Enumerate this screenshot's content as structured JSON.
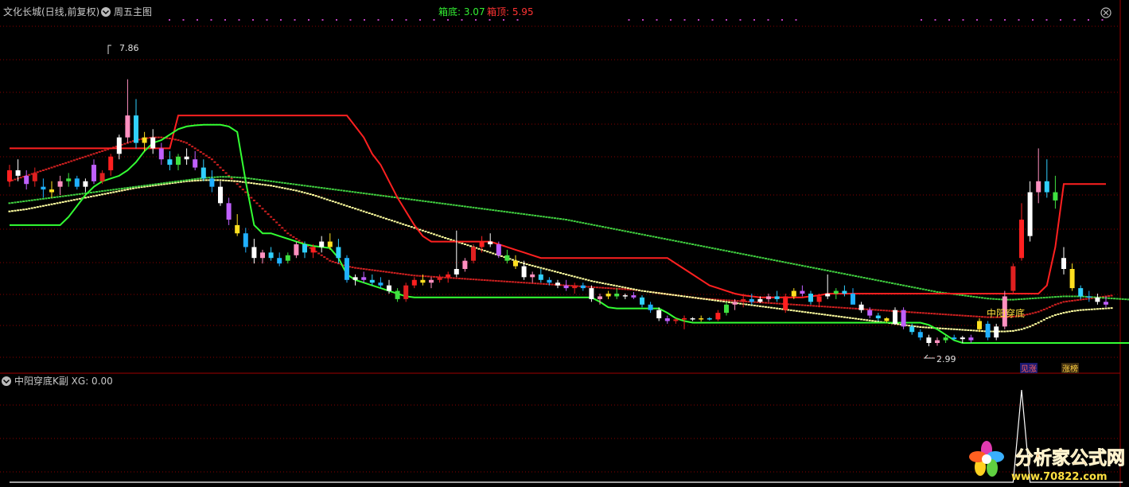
{
  "main_panel": {
    "stock_title": "文化长城(日线,前复权)",
    "indicator_name": "周五主图",
    "box_bottom_label": "箱底: 3.07",
    "box_top_label": "箱顶: 5.95",
    "high_label": "7.86",
    "low_label": "2.99",
    "signal_label": "中阳穿底",
    "tag_one": "见涨",
    "tag_two": "涨榜"
  },
  "sub_panel": {
    "title": "中阳穿底K副 XG: 0.00"
  },
  "watermark": {
    "name": "分析家公式网",
    "url": "www.70822.com"
  },
  "colors": {
    "background": "#000000",
    "grid": "#8a0000",
    "box_line": "#ff2020",
    "support_line": "#33ff33",
    "ma_red": "#d02020",
    "ma_yellow": "#ffffa0",
    "ma_green": "#40d040",
    "signal_spike": "#ffffff",
    "box_bottom_text": "#33ee33",
    "box_top_text": "#ff3333"
  },
  "icons": {
    "menu": "chevron-down-icon",
    "close": "close-icon"
  },
  "chart_data": {
    "type": "candlestick",
    "y_range": [
      2.6,
      8.9
    ],
    "price_high": 7.86,
    "price_low": 2.99,
    "box_bottom": 3.07,
    "box_top": 5.95,
    "candles": [
      [
        6.0,
        6.3,
        5.9,
        6.2
      ],
      [
        6.2,
        6.4,
        6.0,
        6.1
      ],
      [
        6.1,
        6.2,
        5.85,
        5.95
      ],
      [
        6.0,
        6.25,
        5.9,
        6.15
      ],
      [
        5.9,
        6.05,
        5.7,
        5.85
      ],
      [
        5.85,
        6.0,
        5.7,
        5.8
      ],
      [
        5.9,
        6.1,
        5.75,
        6.0
      ],
      [
        6.0,
        6.15,
        5.9,
        6.05
      ],
      [
        6.05,
        6.1,
        5.85,
        5.9
      ],
      [
        5.9,
        6.05,
        5.8,
        6.0
      ],
      [
        6.3,
        6.4,
        5.95,
        6.0
      ],
      [
        6.0,
        6.2,
        5.95,
        6.15
      ],
      [
        6.2,
        6.5,
        6.1,
        6.45
      ],
      [
        6.5,
        6.85,
        6.4,
        6.8
      ],
      [
        6.8,
        7.86,
        6.7,
        7.2
      ],
      [
        7.2,
        7.5,
        6.6,
        6.7
      ],
      [
        6.7,
        6.9,
        6.55,
        6.8
      ],
      [
        6.8,
        6.95,
        6.5,
        6.6
      ],
      [
        6.6,
        6.7,
        6.3,
        6.4
      ],
      [
        6.4,
        6.55,
        6.2,
        6.3
      ],
      [
        6.3,
        6.5,
        6.2,
        6.45
      ],
      [
        6.45,
        6.6,
        6.3,
        6.4
      ],
      [
        6.4,
        6.55,
        6.2,
        6.25
      ],
      [
        6.25,
        6.4,
        6.0,
        6.05
      ],
      [
        6.05,
        6.2,
        5.8,
        5.9
      ],
      [
        5.9,
        6.0,
        5.55,
        5.6
      ],
      [
        5.6,
        5.7,
        5.2,
        5.3
      ],
      [
        5.2,
        5.4,
        5.0,
        5.05
      ],
      [
        5.05,
        5.15,
        4.7,
        4.8
      ],
      [
        4.8,
        4.95,
        4.5,
        4.6
      ],
      [
        4.6,
        4.75,
        4.5,
        4.7
      ],
      [
        4.7,
        4.8,
        4.55,
        4.6
      ],
      [
        4.6,
        4.7,
        4.45,
        4.5
      ],
      [
        4.55,
        4.7,
        4.5,
        4.65
      ],
      [
        4.65,
        4.9,
        4.6,
        4.85
      ],
      [
        4.85,
        4.9,
        4.6,
        4.7
      ],
      [
        4.7,
        4.85,
        4.6,
        4.8
      ],
      [
        4.8,
        5.0,
        4.7,
        4.9
      ],
      [
        4.9,
        5.05,
        4.75,
        4.8
      ],
      [
        4.8,
        4.95,
        4.5,
        4.6
      ],
      [
        4.6,
        4.65,
        4.15,
        4.2
      ],
      [
        4.2,
        4.3,
        4.1,
        4.25
      ],
      [
        4.25,
        4.35,
        4.15,
        4.2
      ],
      [
        4.2,
        4.3,
        4.1,
        4.15
      ],
      [
        4.15,
        4.25,
        4.05,
        4.1
      ],
      [
        4.1,
        4.2,
        3.95,
        4.0
      ],
      [
        4.0,
        4.05,
        3.8,
        3.85
      ],
      [
        3.85,
        4.15,
        3.8,
        4.1
      ],
      [
        4.1,
        4.25,
        4.05,
        4.2
      ],
      [
        4.2,
        4.3,
        4.1,
        4.15
      ],
      [
        4.15,
        4.25,
        4.05,
        4.2
      ],
      [
        4.2,
        4.3,
        4.15,
        4.25
      ],
      [
        4.25,
        4.35,
        4.15,
        4.3
      ],
      [
        4.3,
        5.1,
        4.25,
        4.4
      ],
      [
        4.4,
        4.6,
        4.35,
        4.55
      ],
      [
        4.55,
        4.85,
        4.5,
        4.8
      ],
      [
        4.8,
        5.0,
        4.7,
        4.9
      ],
      [
        4.9,
        5.05,
        4.8,
        4.85
      ],
      [
        4.85,
        4.9,
        4.6,
        4.65
      ],
      [
        4.65,
        4.75,
        4.5,
        4.55
      ],
      [
        4.55,
        4.65,
        4.4,
        4.45
      ],
      [
        4.45,
        4.55,
        4.2,
        4.25
      ],
      [
        4.25,
        4.35,
        4.15,
        4.3
      ],
      [
        4.3,
        4.4,
        4.15,
        4.2
      ],
      [
        4.2,
        4.25,
        4.1,
        4.15
      ],
      [
        4.15,
        4.2,
        4.05,
        4.1
      ],
      [
        4.1,
        4.2,
        4.0,
        4.05
      ],
      [
        4.05,
        4.15,
        3.95,
        4.1
      ],
      [
        4.1,
        4.15,
        4.0,
        4.05
      ],
      [
        4.05,
        4.1,
        3.8,
        3.85
      ],
      [
        3.85,
        3.95,
        3.75,
        3.9
      ],
      [
        3.9,
        4.0,
        3.85,
        3.95
      ],
      [
        3.95,
        4.05,
        3.85,
        3.9
      ],
      [
        3.9,
        3.95,
        3.85,
        3.92
      ],
      [
        3.92,
        3.98,
        3.85,
        3.88
      ],
      [
        3.88,
        3.92,
        3.7,
        3.75
      ],
      [
        3.75,
        3.8,
        3.6,
        3.65
      ],
      [
        3.65,
        3.7,
        3.45,
        3.5
      ],
      [
        3.5,
        3.55,
        3.4,
        3.45
      ],
      [
        3.45,
        3.5,
        3.4,
        3.48
      ],
      [
        3.48,
        3.55,
        3.3,
        3.5
      ],
      [
        3.5,
        3.52,
        3.45,
        3.48
      ],
      [
        3.48,
        3.55,
        3.44,
        3.5
      ],
      [
        3.5,
        3.52,
        3.46,
        3.48
      ],
      [
        3.48,
        3.65,
        3.45,
        3.6
      ],
      [
        3.6,
        3.8,
        3.55,
        3.75
      ],
      [
        3.75,
        3.85,
        3.65,
        3.8
      ],
      [
        3.8,
        3.95,
        3.7,
        3.85
      ],
      [
        3.85,
        3.95,
        3.75,
        3.8
      ],
      [
        3.8,
        3.9,
        3.78,
        3.85
      ],
      [
        3.85,
        3.95,
        3.8,
        3.9
      ],
      [
        3.9,
        4.0,
        3.8,
        3.85
      ],
      [
        3.65,
        3.95,
        3.6,
        3.9
      ],
      [
        3.9,
        4.05,
        3.85,
        4.0
      ],
      [
        4.0,
        4.1,
        3.9,
        3.95
      ],
      [
        3.95,
        4.0,
        3.75,
        3.8
      ],
      [
        3.8,
        3.95,
        3.7,
        3.9
      ],
      [
        3.9,
        4.3,
        3.85,
        3.95
      ],
      [
        3.95,
        4.05,
        3.85,
        4.0
      ],
      [
        4.0,
        4.1,
        3.9,
        3.95
      ],
      [
        3.95,
        4.05,
        3.85,
        3.75
      ],
      [
        3.75,
        3.8,
        3.6,
        3.65
      ],
      [
        3.65,
        3.7,
        3.5,
        3.55
      ],
      [
        3.55,
        3.6,
        3.45,
        3.5
      ],
      [
        3.5,
        3.52,
        3.42,
        3.45
      ],
      [
        3.4,
        3.7,
        3.38,
        3.65
      ],
      [
        3.65,
        3.7,
        3.3,
        3.35
      ],
      [
        3.35,
        3.4,
        3.2,
        3.25
      ],
      [
        3.25,
        3.3,
        3.1,
        3.15
      ],
      [
        3.15,
        3.2,
        2.99,
        3.05
      ],
      [
        3.05,
        3.15,
        3.0,
        3.1
      ],
      [
        3.1,
        3.2,
        3.05,
        3.15
      ],
      [
        3.15,
        3.2,
        3.1,
        3.12
      ],
      [
        3.12,
        3.18,
        3.05,
        3.15
      ],
      [
        3.15,
        3.2,
        3.05,
        3.1
      ],
      [
        3.3,
        3.5,
        3.25,
        3.45
      ],
      [
        3.4,
        3.45,
        3.1,
        3.15
      ],
      [
        3.15,
        3.4,
        3.1,
        3.35
      ],
      [
        3.35,
        4.0,
        3.3,
        3.9
      ],
      [
        4.0,
        4.5,
        3.95,
        4.45
      ],
      [
        4.6,
        5.6,
        4.55,
        5.3
      ],
      [
        5.0,
        6.0,
        4.9,
        5.8
      ],
      [
        5.8,
        6.6,
        5.6,
        6.0
      ],
      [
        6.0,
        6.4,
        5.7,
        5.8
      ],
      [
        5.8,
        6.1,
        5.5,
        5.65
      ],
      [
        4.6,
        4.8,
        4.3,
        4.4
      ],
      [
        4.4,
        4.5,
        4.0,
        4.05
      ],
      [
        4.05,
        4.1,
        3.85,
        3.9
      ],
      [
        3.9,
        4.0,
        3.8,
        3.88
      ],
      [
        3.88,
        3.95,
        3.75,
        3.8
      ],
      [
        3.8,
        3.9,
        3.7,
        3.75
      ]
    ],
    "box_line": [
      6.6,
      6.6,
      6.6,
      6.6,
      6.6,
      6.6,
      6.6,
      6.6,
      6.6,
      6.6,
      6.6,
      6.6,
      6.6,
      6.6,
      6.6,
      6.6,
      6.6,
      6.6,
      6.6,
      6.6,
      7.2,
      7.2,
      7.2,
      7.2,
      7.2,
      7.2,
      7.2,
      7.2,
      7.2,
      7.2,
      7.2,
      7.2,
      7.2,
      7.2,
      7.2,
      7.2,
      7.2,
      7.2,
      7.2,
      7.2,
      7.2,
      7.0,
      6.8,
      6.5,
      6.3,
      6.0,
      5.7,
      5.45,
      5.2,
      5.0,
      4.9,
      4.9,
      4.9,
      4.9,
      4.9,
      4.9,
      4.9,
      4.9,
      4.85,
      4.8,
      4.75,
      4.7,
      4.65,
      4.6,
      4.6,
      4.6,
      4.6,
      4.6,
      4.6,
      4.6,
      4.6,
      4.6,
      4.6,
      4.6,
      4.6,
      4.6,
      4.6,
      4.6,
      4.6,
      4.5,
      4.4,
      4.3,
      4.2,
      4.1,
      4.05,
      4.0,
      3.95,
      3.92,
      3.9,
      3.88,
      3.88,
      3.88,
      3.88,
      3.88,
      3.88,
      3.9,
      3.92,
      3.95,
      3.95,
      3.95,
      3.95,
      3.95,
      3.95,
      3.95,
      3.95,
      3.95,
      3.95,
      3.95,
      3.95,
      3.95,
      3.95,
      3.95,
      3.95,
      3.95,
      3.95,
      3.95,
      3.95,
      3.95,
      3.95,
      3.95,
      3.95,
      3.95,
      3.95,
      4.1,
      4.8,
      5.95,
      5.95,
      5.95,
      5.95,
      5.95,
      5.95
    ],
    "support_line": [
      5.2,
      5.2,
      5.2,
      5.2,
      5.2,
      5.2,
      5.2,
      5.35,
      5.55,
      5.75,
      5.9,
      6.0,
      6.05,
      6.1,
      6.2,
      6.35,
      6.55,
      6.7,
      6.75,
      6.85,
      6.95,
      7.0,
      7.02,
      7.03,
      7.03,
      7.03,
      7.0,
      6.9,
      6.0,
      5.2,
      5.05,
      5.05,
      5.0,
      4.95,
      4.9,
      4.85,
      4.82,
      4.8,
      4.78,
      4.6,
      4.3,
      4.2,
      4.15,
      4.1,
      4.05,
      4.0,
      3.95,
      3.9,
      3.88,
      3.88,
      3.88,
      3.88,
      3.88,
      3.88,
      3.88,
      3.88,
      3.88,
      3.88,
      3.88,
      3.88,
      3.88,
      3.88,
      3.88,
      3.88,
      3.88,
      3.88,
      3.88,
      3.88,
      3.88,
      3.88,
      3.8,
      3.7,
      3.68,
      3.68,
      3.68,
      3.68,
      3.68,
      3.68,
      3.6,
      3.5,
      3.45,
      3.42,
      3.42,
      3.42,
      3.42,
      3.42,
      3.42,
      3.42,
      3.42,
      3.42,
      3.42,
      3.42,
      3.42,
      3.42,
      3.42,
      3.42,
      3.42,
      3.42,
      3.42,
      3.42,
      3.42,
      3.42,
      3.42,
      3.42,
      3.42,
      3.42,
      3.42,
      3.42,
      3.42,
      3.38,
      3.3,
      3.2,
      3.1,
      3.05,
      3.05,
      3.05,
      3.05,
      3.05,
      3.05,
      3.05,
      3.05,
      3.05,
      3.05,
      3.05,
      3.05,
      3.05,
      3.05,
      3.05,
      3.05,
      3.05,
      3.05,
      3.05,
      3.05,
      3.05,
      3.05
    ],
    "ma_red": [
      6.0,
      6.05,
      6.1,
      6.15,
      6.2,
      6.25,
      6.3,
      6.35,
      6.4,
      6.45,
      6.5,
      6.55,
      6.6,
      6.65,
      6.7,
      6.75,
      6.78,
      6.8,
      6.8,
      6.78,
      6.75,
      6.7,
      6.6,
      6.5,
      6.4,
      6.25,
      6.1,
      5.95,
      5.8,
      5.65,
      5.5,
      5.35,
      5.2,
      5.05,
      4.95,
      4.85,
      4.75,
      4.65,
      4.55,
      4.5,
      4.45,
      4.42,
      4.4,
      4.38,
      4.36,
      4.34,
      4.32,
      4.3,
      4.28,
      4.27,
      4.26,
      4.25,
      4.24,
      4.23,
      4.22,
      4.21,
      4.2,
      4.19,
      4.18,
      4.17,
      4.16,
      4.15,
      4.14,
      4.13,
      4.12,
      4.11,
      4.1,
      4.09,
      4.08,
      4.07,
      4.06,
      4.05,
      4.04,
      4.03,
      4.02,
      4.0,
      3.98,
      3.96,
      3.94,
      3.92,
      3.9,
      3.88,
      3.86,
      3.85,
      3.84,
      3.83,
      3.82,
      3.81,
      3.8,
      3.79,
      3.78,
      3.77,
      3.76,
      3.75,
      3.74,
      3.73,
      3.72,
      3.71,
      3.7,
      3.69,
      3.68,
      3.67,
      3.66,
      3.65,
      3.64,
      3.63,
      3.62,
      3.61,
      3.6,
      3.59,
      3.58,
      3.57,
      3.56,
      3.55,
      3.54,
      3.53,
      3.52,
      3.52,
      3.52,
      3.53,
      3.55,
      3.58,
      3.62,
      3.68,
      3.75,
      3.8,
      3.82,
      3.84,
      3.86,
      3.88,
      3.9,
      3.92
    ],
    "ma_yellow": [
      5.45,
      5.47,
      5.49,
      5.52,
      5.55,
      5.58,
      5.61,
      5.64,
      5.67,
      5.7,
      5.73,
      5.76,
      5.79,
      5.82,
      5.85,
      5.88,
      5.9,
      5.92,
      5.94,
      5.96,
      5.98,
      6.0,
      6.01,
      6.02,
      6.02,
      6.02,
      6.01,
      6.0,
      5.98,
      5.96,
      5.94,
      5.92,
      5.89,
      5.86,
      5.83,
      5.79,
      5.75,
      5.7,
      5.65,
      5.6,
      5.55,
      5.5,
      5.45,
      5.4,
      5.35,
      5.3,
      5.25,
      5.2,
      5.15,
      5.1,
      5.05,
      5.0,
      4.95,
      4.9,
      4.85,
      4.8,
      4.75,
      4.7,
      4.65,
      4.6,
      4.55,
      4.5,
      4.46,
      4.42,
      4.38,
      4.34,
      4.3,
      4.26,
      4.22,
      4.18,
      4.15,
      4.12,
      4.09,
      4.06,
      4.03,
      4.0,
      3.98,
      3.96,
      3.94,
      3.92,
      3.9,
      3.88,
      3.86,
      3.84,
      3.82,
      3.8,
      3.78,
      3.76,
      3.74,
      3.72,
      3.7,
      3.68,
      3.66,
      3.64,
      3.62,
      3.6,
      3.58,
      3.56,
      3.54,
      3.52,
      3.5,
      3.48,
      3.46,
      3.44,
      3.42,
      3.4,
      3.38,
      3.36,
      3.34,
      3.33,
      3.32,
      3.31,
      3.3,
      3.29,
      3.28,
      3.27,
      3.26,
      3.26,
      3.26,
      3.27,
      3.3,
      3.35,
      3.42,
      3.5,
      3.56,
      3.6,
      3.63,
      3.65,
      3.66,
      3.67,
      3.68,
      3.69
    ],
    "ma_green": [
      5.6,
      5.62,
      5.64,
      5.66,
      5.68,
      5.7,
      5.72,
      5.74,
      5.76,
      5.78,
      5.8,
      5.82,
      5.84,
      5.86,
      5.88,
      5.9,
      5.92,
      5.94,
      5.96,
      5.98,
      6.0,
      6.02,
      6.04,
      6.06,
      6.07,
      6.08,
      6.08,
      6.07,
      6.06,
      6.04,
      6.02,
      6.0,
      5.98,
      5.96,
      5.94,
      5.92,
      5.9,
      5.88,
      5.86,
      5.84,
      5.82,
      5.8,
      5.78,
      5.76,
      5.74,
      5.72,
      5.7,
      5.68,
      5.66,
      5.64,
      5.62,
      5.6,
      5.58,
      5.56,
      5.54,
      5.52,
      5.5,
      5.48,
      5.46,
      5.44,
      5.42,
      5.4,
      5.38,
      5.36,
      5.34,
      5.32,
      5.3,
      5.27,
      5.24,
      5.21,
      5.18,
      5.15,
      5.12,
      5.09,
      5.06,
      5.03,
      5.0,
      4.97,
      4.94,
      4.91,
      4.88,
      4.85,
      4.82,
      4.79,
      4.76,
      4.73,
      4.7,
      4.67,
      4.64,
      4.61,
      4.58,
      4.55,
      4.52,
      4.49,
      4.46,
      4.43,
      4.4,
      4.37,
      4.34,
      4.31,
      4.28,
      4.25,
      4.22,
      4.19,
      4.16,
      4.13,
      4.1,
      4.07,
      4.04,
      4.01,
      3.98,
      3.96,
      3.94,
      3.92,
      3.9,
      3.88,
      3.86,
      3.85,
      3.84,
      3.84,
      3.85,
      3.86,
      3.87,
      3.88,
      3.89,
      3.9,
      3.9,
      3.9,
      3.89,
      3.88,
      3.87,
      3.86,
      3.85,
      3.84
    ],
    "signal_values": [
      0,
      0,
      0,
      0,
      0,
      0,
      0,
      0,
      0,
      0,
      0,
      0,
      0,
      0,
      0,
      0,
      0,
      0,
      0,
      0,
      0,
      0,
      0,
      0,
      0,
      0,
      0,
      0,
      0,
      0,
      0,
      0,
      0,
      0,
      0,
      0,
      0,
      0,
      0,
      0,
      0,
      0,
      0,
      0,
      0,
      0,
      0,
      0,
      0,
      0,
      0,
      0,
      0,
      0,
      0,
      0,
      0,
      0,
      0,
      0,
      0,
      0,
      0,
      0,
      0,
      0,
      0,
      0,
      0,
      0,
      0,
      0,
      0,
      0,
      0,
      0,
      0,
      0,
      0,
      0,
      0,
      0,
      0,
      0,
      0,
      0,
      0,
      0,
      0,
      0,
      0,
      0,
      0,
      0,
      0,
      0,
      0,
      0,
      0,
      0,
      0,
      0,
      0,
      0,
      0,
      0,
      0,
      0,
      0,
      0,
      0,
      0,
      0,
      0,
      0,
      0,
      0,
      0,
      0,
      0,
      1,
      0,
      0,
      0,
      0,
      0,
      0,
      0,
      0,
      0,
      0,
      0,
      0
    ]
  }
}
